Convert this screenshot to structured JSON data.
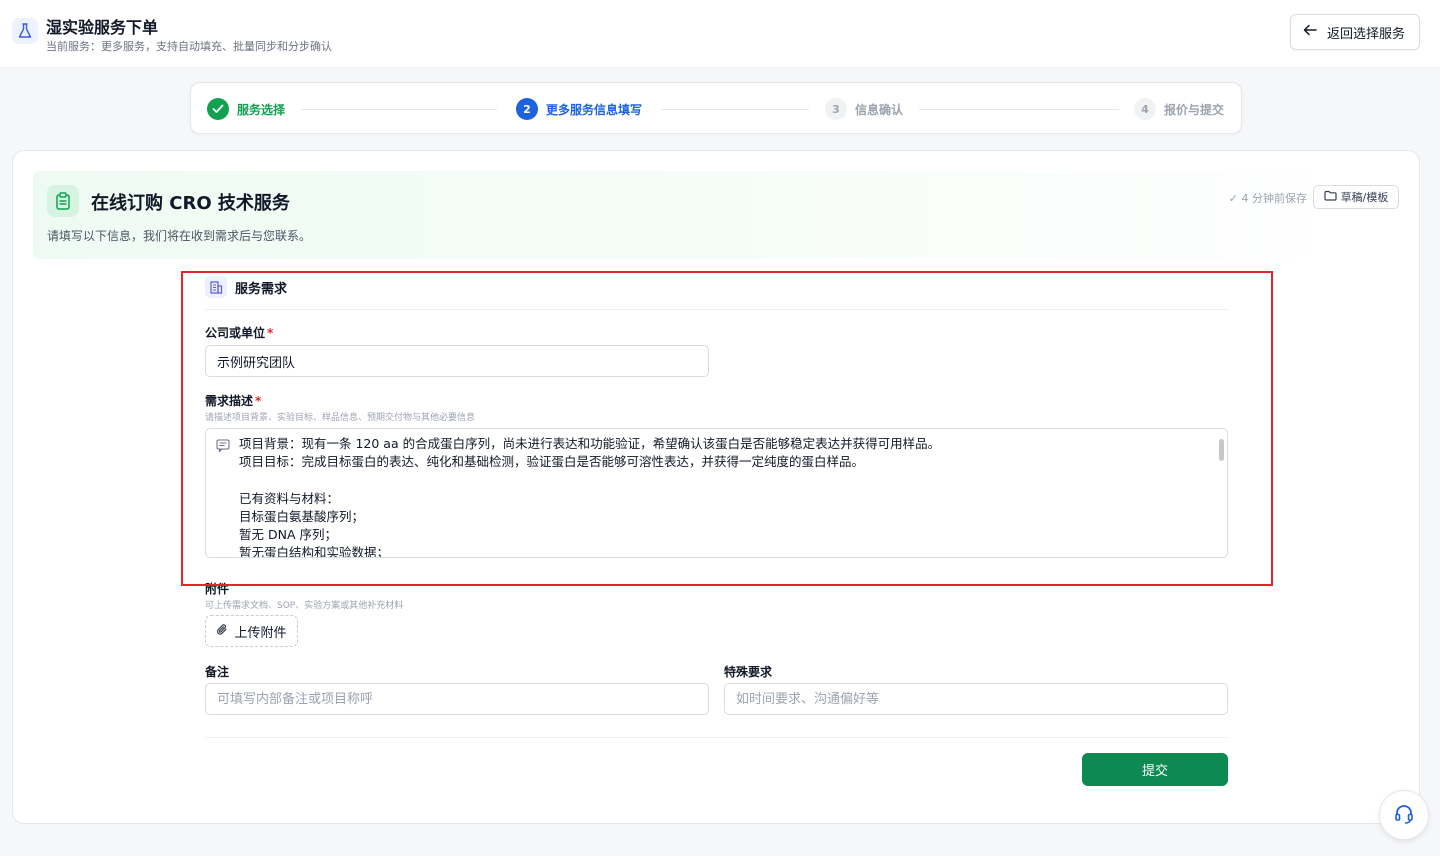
{
  "header": {
    "title": "湿实验服务下单",
    "subtitle": "当前服务：更多服务，支持自动填充、批量同步和分步确认",
    "back_label": "返回选择服务"
  },
  "steps": [
    {
      "number": "1",
      "label": "服务选择",
      "state": "done"
    },
    {
      "number": "2",
      "label": "更多服务信息填写",
      "state": "active"
    },
    {
      "number": "3",
      "label": "信息确认",
      "state": "todo"
    },
    {
      "number": "4",
      "label": "报价与提交",
      "state": "todo"
    }
  ],
  "banner": {
    "title": "在线订购 CRO 技术服务",
    "description": "请填写以下信息，我们将在收到需求后与您联系。",
    "saved_status": "✓ 4 分钟前保存",
    "draft_label": "草稿/模板"
  },
  "section": {
    "title": "服务需求"
  },
  "form": {
    "company": {
      "label": "公司或单位",
      "required_mark": "*",
      "value": "示例研究团队"
    },
    "description": {
      "label": "需求描述",
      "required_mark": "*",
      "hint": "请描述项目背景、实验目标、样品信息、预期交付物与其他必要信息",
      "value": "项目背景：现有一条 120 aa 的合成蛋白序列，尚未进行表达和功能验证，希望确认该蛋白是否能够稳定表达并获得可用样品。\n项目目标：完成目标蛋白的表达、纯化和基础检测，验证蛋白是否能够可溶性表达，并获得一定纯度的蛋白样品。\n\n已有资料与材料：\n目标蛋白氨基酸序列；\n暂无 DNA 序列；\n暂无蛋白结构和实验数据；"
    },
    "attachment": {
      "label": "附件",
      "hint": "可上传需求文档、SOP、实验方案或其他补充材料",
      "upload_label": "上传附件"
    },
    "remark": {
      "label": "备注",
      "placeholder": "可填写内部备注或项目称呼"
    },
    "special": {
      "label": "特殊要求",
      "placeholder": "如时间要求、沟通偏好等"
    },
    "submit_label": "提交"
  },
  "colors": {
    "primary_green": "#0d8a52",
    "done_green": "#12a150",
    "active_blue": "#1d63e0",
    "highlight_red": "#e3262c"
  }
}
